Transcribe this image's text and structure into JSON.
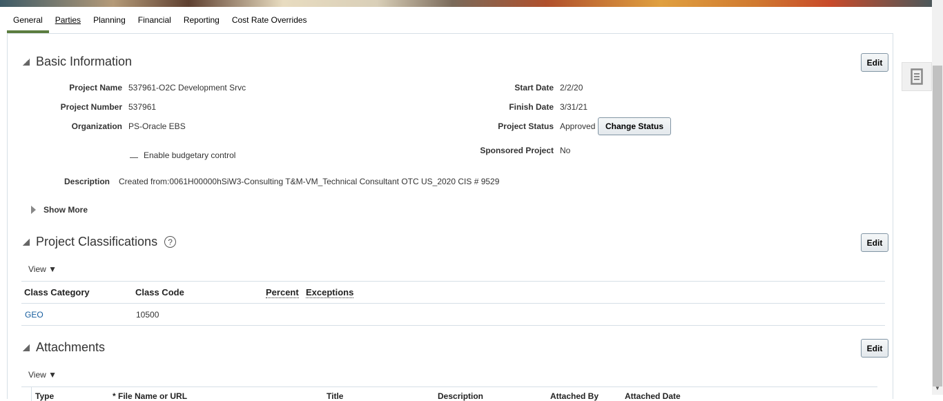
{
  "tabs": [
    {
      "label": "General",
      "active": true
    },
    {
      "label": "Parties"
    },
    {
      "label": "Planning"
    },
    {
      "label": "Financial"
    },
    {
      "label": "Reporting"
    },
    {
      "label": "Cost Rate Overrides"
    }
  ],
  "basic": {
    "title": "Basic Information",
    "edit": "Edit",
    "project_name_label": "Project Name",
    "project_name": "537961-O2C Development Srvc",
    "project_number_label": "Project Number",
    "project_number": "537961",
    "organization_label": "Organization",
    "organization": "PS-Oracle EBS",
    "budgetary_control": "Enable budgetary control",
    "start_date_label": "Start Date",
    "start_date": "2/2/20",
    "finish_date_label": "Finish Date",
    "finish_date": "3/31/21",
    "status_label": "Project Status",
    "status": "Approved",
    "change_status": "Change Status",
    "sponsored_label": "Sponsored Project",
    "sponsored": "No",
    "description_label": "Description",
    "description": "Created from:0061H00000hSiW3-Consulting T&M-VM_Technical Consultant OTC US_2020 CIS # 9529",
    "show_more": "Show More"
  },
  "classifications": {
    "title": "Project Classifications",
    "help": "?",
    "edit": "Edit",
    "view": "View",
    "columns": [
      "Class Category",
      "Class Code",
      "Percent",
      "Exceptions"
    ],
    "rows": [
      [
        "GEO",
        "10500",
        "",
        ""
      ]
    ]
  },
  "attachments": {
    "title": "Attachments",
    "edit": "Edit",
    "view": "View",
    "columns": [
      "Type",
      "* File Name or URL",
      "Title",
      "Description",
      "Attached By",
      "Attached Date"
    ]
  },
  "colors": {
    "accent": "#5b7d3f",
    "link": "#145c9e"
  }
}
